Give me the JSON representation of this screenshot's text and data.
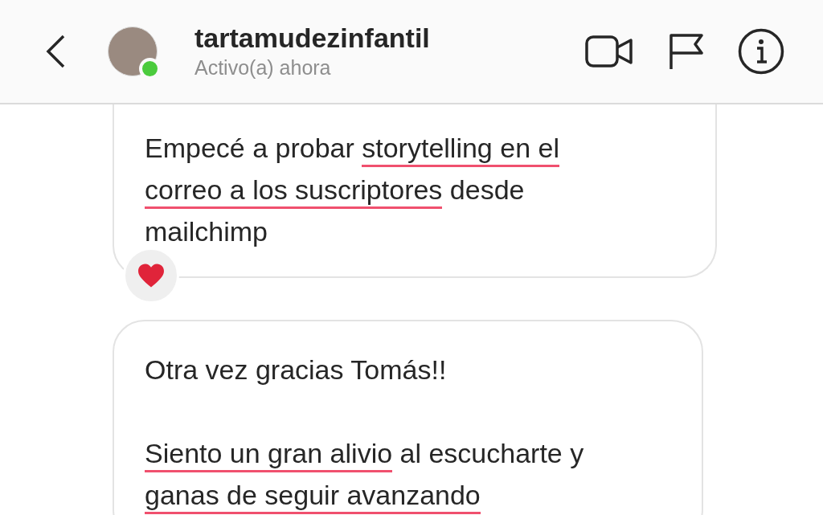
{
  "header": {
    "username": "tartamudezinfantil",
    "status": "Activo(a) ahora",
    "online": true
  },
  "messages": [
    {
      "kind": "text",
      "cut_top": true,
      "reaction": true,
      "paragraphs": [
        [
          {
            "text": "Empecé a probar ",
            "underlined": false
          },
          {
            "text": "storytelling en el correo a los suscriptores",
            "underlined": true
          },
          {
            "text": " desde mailchimp",
            "underlined": false
          }
        ]
      ]
    },
    {
      "kind": "text",
      "cut_top": false,
      "reaction": false,
      "paragraphs": [
        [
          {
            "text": "Otra vez gracias Tomás!!",
            "underlined": false
          }
        ],
        [
          {
            "text": "Siento un gran alivio",
            "underlined": true
          },
          {
            "text": " al escucharte y ",
            "underlined": false
          },
          {
            "text": "ganas de seguir avanzando",
            "underlined": true
          }
        ]
      ]
    }
  ]
}
